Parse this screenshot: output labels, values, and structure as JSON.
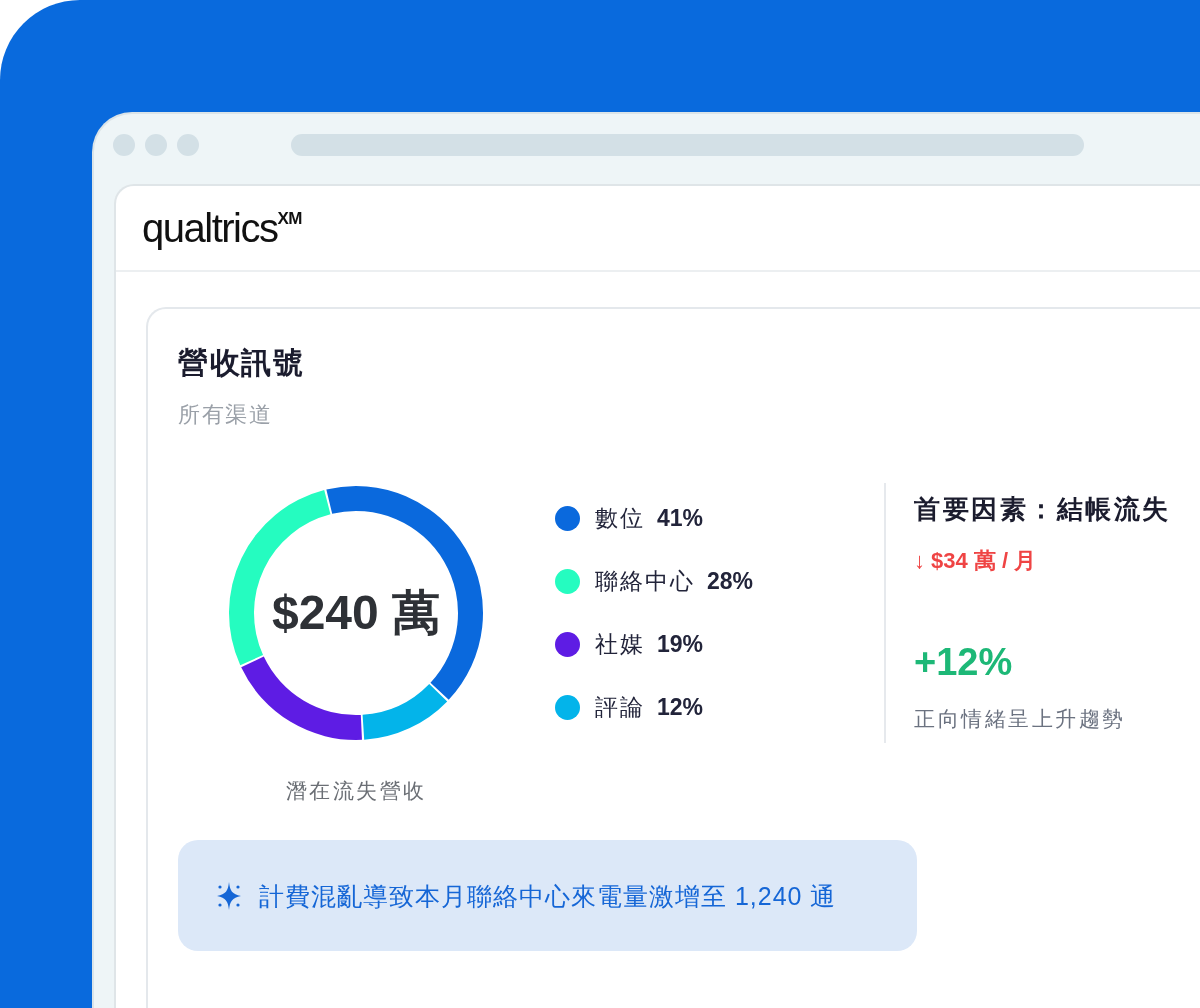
{
  "browser": {
    "logo": "qualtrics$^{XM}$"
  },
  "card": {
    "title": "營收訊號",
    "subtitle": "所有渠道",
    "donut": {
      "center_value": "$240 萬",
      "caption": "潛在流失營收",
      "chart_data": {
        "type": "donut",
        "categories": [
          "數位",
          "聯絡中心",
          "社媒",
          "評論"
        ],
        "values": [
          41,
          28,
          19,
          12
        ],
        "value_labels": [
          "41%",
          "28%",
          "19%",
          "12%"
        ],
        "colors": [
          "#0a69dd",
          "#25fcc0",
          "#5e1ce4",
          "#03b4ea"
        ]
      }
    },
    "driver": {
      "title": "首要因素：結帳流失",
      "impact": "↓ $34 萬 / 月",
      "change": "+12%",
      "change_note": "正向情緒呈上升趨勢"
    },
    "insight": {
      "text": "計費混亂導致本月聯絡中心來電量激增至 1,240 通"
    }
  }
}
